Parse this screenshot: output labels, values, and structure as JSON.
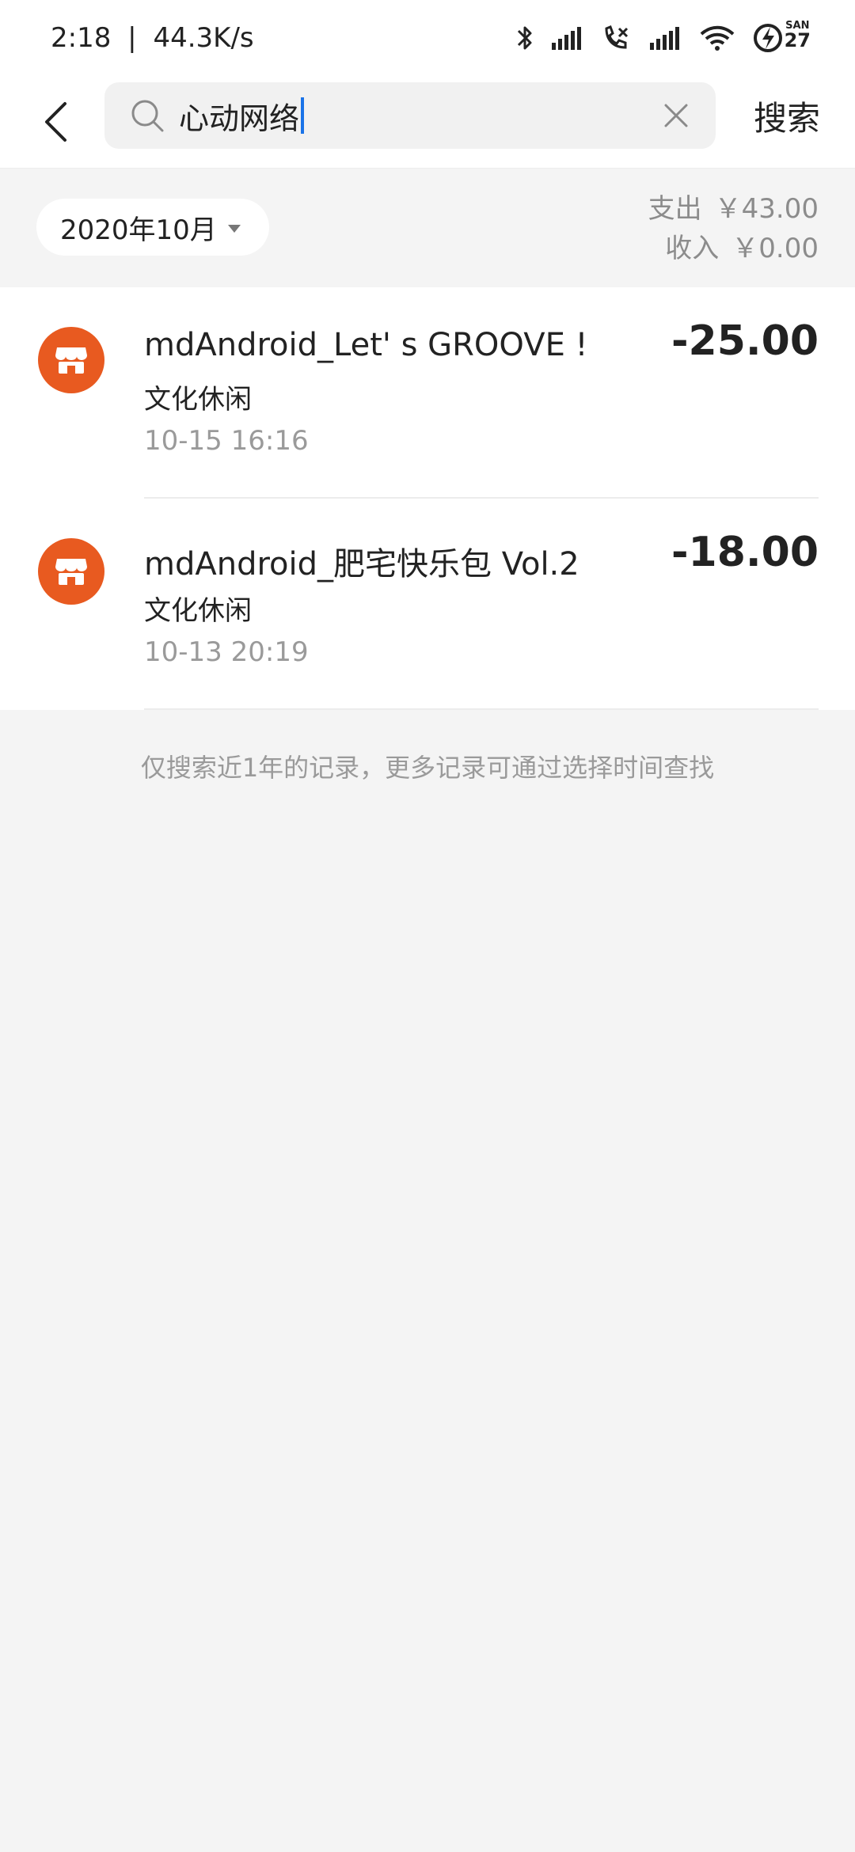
{
  "status_bar": {
    "time": "2:18",
    "separator": "|",
    "network_speed": "44.3K/s",
    "icons": [
      "bluetooth-icon",
      "signal-icon",
      "call-icon",
      "signal-icon",
      "wifi-icon",
      "battery-charging-icon"
    ],
    "date_badge": {
      "day_of_week": "SAN",
      "day": "27"
    }
  },
  "header": {
    "back_icon": "chevron-left-icon",
    "search": {
      "icon": "search-icon",
      "value": "心动网络",
      "clear_icon": "close-icon"
    },
    "search_button_label": "搜索"
  },
  "filter": {
    "month_label": "2020年10月",
    "dropdown_icon": "caret-down-icon",
    "summary": {
      "expense_label": "支出",
      "expense_value": "￥43.00",
      "income_label": "收入",
      "income_value": "￥0.00"
    }
  },
  "transactions": [
    {
      "icon": "store-icon",
      "title": "mdAndroid_Let' s GROOVE !",
      "category": "文化休闲",
      "time": "10-15  16:16",
      "amount": "-25.00"
    },
    {
      "icon": "store-icon",
      "title": "mdAndroid_肥宅快乐包 Vol.2",
      "category": "文化休闲",
      "time": "10-13  20:19",
      "amount": "-18.00"
    }
  ],
  "footer_note": "仅搜索近1年的记录，更多记录可通过选择时间查找",
  "colors": {
    "accent": "#e85a20",
    "caret": "#1a73e8",
    "background": "#f4f4f4"
  }
}
